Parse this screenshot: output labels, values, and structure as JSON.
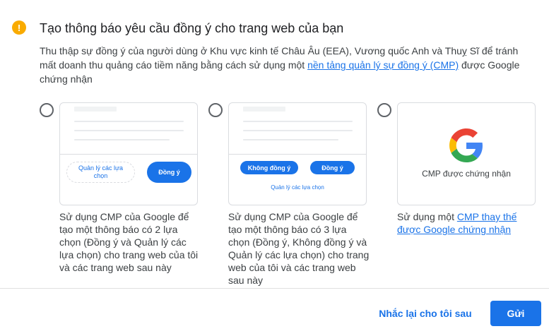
{
  "dialog": {
    "title": "Tạo thông báo yêu cầu đồng ý cho trang web của bạn",
    "desc_before": "Thu thập sự đồng ý của người dùng ở Khu vực kinh tế Châu Âu (EEA), Vương quốc Anh và Thuỵ Sĩ để tránh mất doanh thu quảng cáo tiềm năng bằng cách sử dụng một ",
    "desc_link": "nền tảng quản lý sự đồng ý (CMP)",
    "desc_after": " được Google chứng nhận",
    "warning_glyph": "!"
  },
  "options": {
    "two_choice": {
      "manage_label": "Quản lý các lựa chọn",
      "consent_label": "Đồng ý",
      "text": "Sử dụng CMP của Google để tạo một thông báo có 2 lựa chọn (Đồng ý và Quản lý các lựa chọn) cho trang web của tôi và các trang web sau này"
    },
    "three_choice": {
      "decline_label": "Không đồng ý",
      "consent_label": "Đồng ý",
      "manage_label": "Quản lý các lựa chọn",
      "text": "Sử dụng CMP của Google để tạo một thông báo có 3 lựa chọn (Đồng ý, Không đồng ý và Quản lý các lựa chọn) cho trang web của tôi và các trang web sau này"
    },
    "certified": {
      "card_label": "CMP được chứng nhận",
      "text_before": "Sử dụng một ",
      "text_link": "CMP thay thế được Google chứng nhận"
    }
  },
  "footer": {
    "remind_label": "Nhắc lại cho tôi sau",
    "send_label": "Gửi"
  },
  "colors": {
    "accent": "#1a73e8",
    "warning": "#f9ab00",
    "google_blue": "#4285f4",
    "google_red": "#ea4335",
    "google_yellow": "#fbbc05",
    "google_green": "#34a853"
  }
}
